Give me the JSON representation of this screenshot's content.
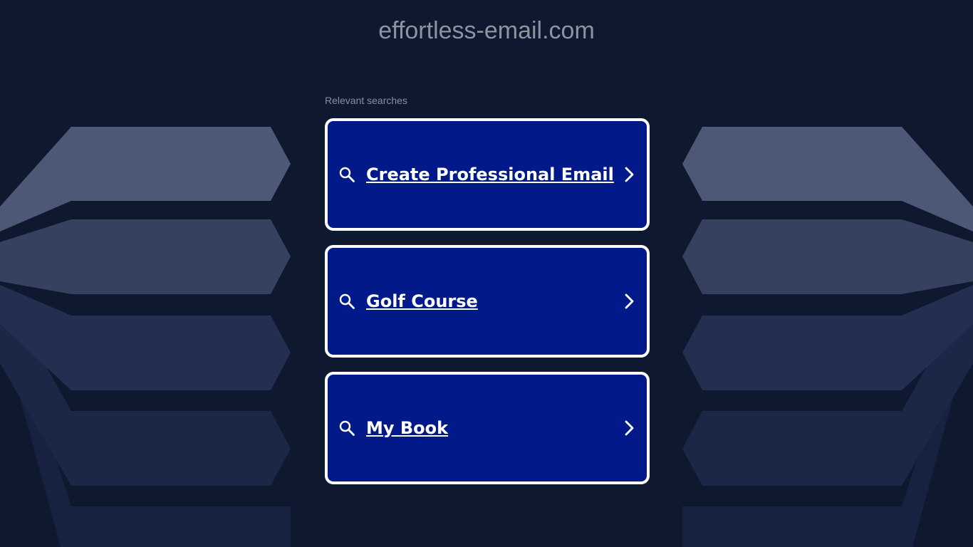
{
  "site": {
    "title": "effortless-email.com"
  },
  "searches": {
    "heading": "Relevant searches",
    "items": [
      {
        "label": "Create Professional Email",
        "icon": "search-icon",
        "trailing_icon": "chevron-right-icon"
      },
      {
        "label": "Golf Course",
        "icon": "search-icon",
        "trailing_icon": "chevron-right-icon"
      },
      {
        "label": "My Book",
        "icon": "search-icon",
        "trailing_icon": "chevron-right-icon"
      }
    ]
  },
  "colors": {
    "background": "#0e182e",
    "card_fill": "#021a89",
    "card_border": "#ffffff",
    "title_text": "#8e93a0",
    "shape_light": "#4c5876",
    "shape_mid": "#2e3b5c",
    "shape_dark": "#1a2747"
  }
}
